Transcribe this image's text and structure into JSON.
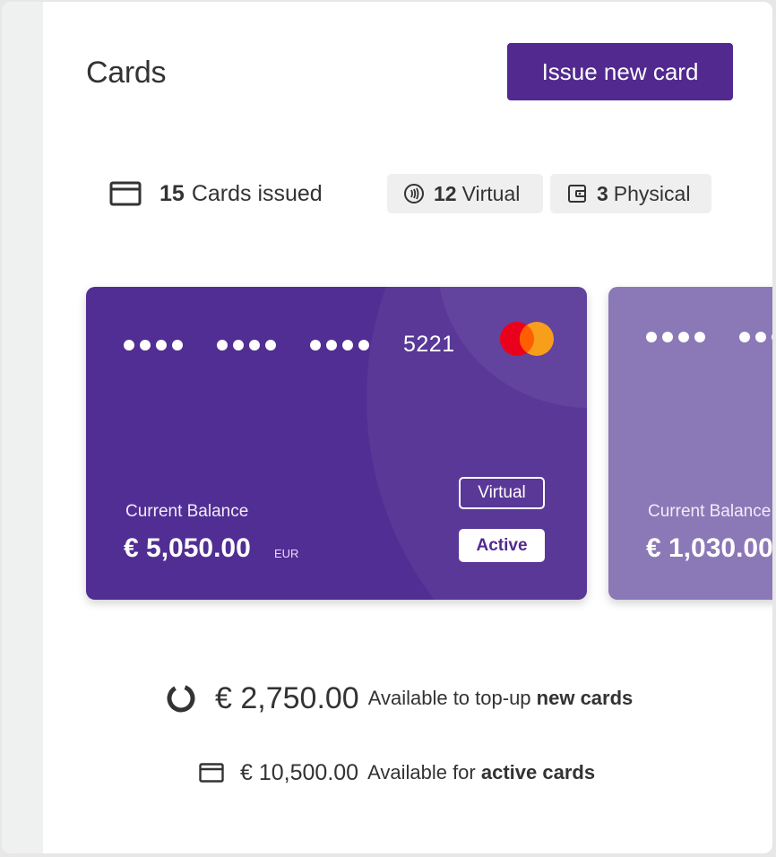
{
  "header": {
    "title": "Cards",
    "issue_button_label": "Issue new card"
  },
  "stats": {
    "total_count": "15",
    "total_label": "Cards issued",
    "virtual_count": "12",
    "virtual_label": "Virtual",
    "physical_count": "3",
    "physical_label": "Physical"
  },
  "cards": [
    {
      "last_four": "5221",
      "balance_label": "Current Balance",
      "balance": "€ 5,050.00",
      "currency": "EUR",
      "type_badge": "Virtual",
      "status_badge": "Active",
      "brand_icon": "mastercard-logo"
    },
    {
      "balance_label": "Current Balance",
      "balance": "€ 1,030.00"
    }
  ],
  "summary": {
    "topup_amount": "€ 2,750.00",
    "topup_text": "Available to top-up",
    "topup_emphasis": "new cards",
    "active_amount": "€ 10,500.00",
    "active_text": "Available for",
    "active_emphasis": "active cards"
  },
  "colors": {
    "brand_purple": "#52298f",
    "secondary_card": "#8b78b7",
    "chip_bg": "#efefef",
    "text_dark": "#333333"
  }
}
